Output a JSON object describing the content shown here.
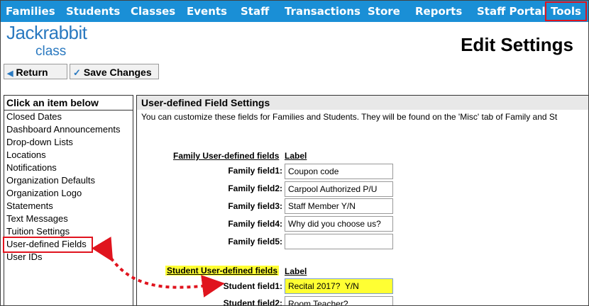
{
  "nav": {
    "items": [
      "Families",
      "Students",
      "Classes",
      "Events",
      "Staff",
      "Transactions",
      "Store",
      "Reports",
      "Staff Portal",
      "Tools"
    ]
  },
  "logo": {
    "word": "Jackrabbit",
    "sub": "class"
  },
  "page": {
    "title": "Edit Settings"
  },
  "toolbar": {
    "return_label": "Return",
    "save_label": "Save Changes"
  },
  "left": {
    "header": "Click an item below",
    "items": [
      "Closed Dates",
      "Dashboard Announcements",
      "Drop-down Lists",
      "Locations",
      "Notifications",
      "Organization Defaults",
      "Organization Logo",
      "Statements",
      "Text Messages",
      "Tuition Settings",
      "User-defined Fields",
      "User IDs"
    ]
  },
  "right": {
    "header": "User-defined Field Settings",
    "description": "You can customize these fields for Families and Students. They will be found on the 'Misc' tab of Family and St",
    "family": {
      "section_label": "Family User-defined fields",
      "col_label": "Label",
      "fields": [
        {
          "label": "Family field1:",
          "value": "Coupon code"
        },
        {
          "label": "Family field2:",
          "value": "Carpool Authorized P/U"
        },
        {
          "label": "Family field3:",
          "value": "Staff Member Y/N"
        },
        {
          "label": "Family field4:",
          "value": "Why did you choose us?"
        },
        {
          "label": "Family field5:",
          "value": ""
        }
      ]
    },
    "student": {
      "section_label": "Student User-defined fields",
      "col_label": "Label",
      "fields": [
        {
          "label": "Student field1:",
          "value": "Recital 2017?  Y/N"
        },
        {
          "label": "Student field2:",
          "value": "Room Teacher?"
        }
      ]
    }
  },
  "colors": {
    "nav_bg": "#1a8fd6",
    "highlight_red": "#e0141e",
    "highlight_yellow": "#ffff33",
    "brand_blue": "#2a79c0"
  }
}
